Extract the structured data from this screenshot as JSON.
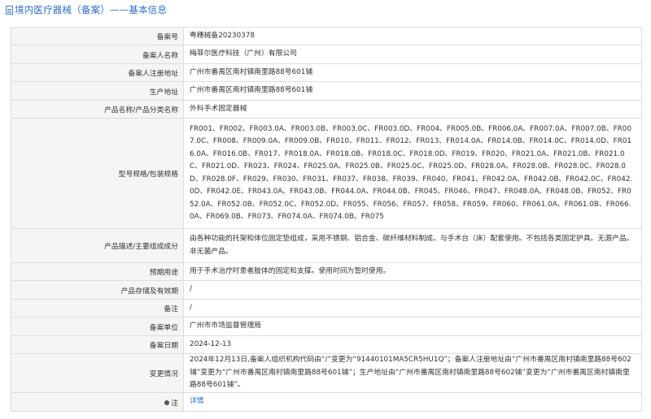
{
  "header": {
    "title": "境内医疗器械（备案）——基本信息",
    "icon": "document-icon"
  },
  "rows": [
    {
      "label": "备案号",
      "value": "粤穗械备20230378"
    },
    {
      "label": "备案人名称",
      "value": "梅菲尔医疗科技（广州）有限公司"
    },
    {
      "label": "备案人注册地址",
      "value": "广州市番禺区南村镇南里路88号601铺"
    },
    {
      "label": "生产地址",
      "value": "广州市番禺区南村镇南里路88号601铺"
    },
    {
      "label": "产品名称/产品分类名称",
      "value": "外科手术固定器械"
    },
    {
      "label": "型号规格/包装规格",
      "value": "FR001、FR002、FR003.0A、FR003.0B、FR003.0C、FR003.0D、FR004、FR005.0B、FR006.0A、FR007.0A、FR007.0B、FR007.0C、FR008、FR009.0A、FR009.0B、FR010、FR011、FR012、FR013、FR014.0A、FR014.0B、FR014.0C、FR014.0D、FR016.0A、FR016.0B、FR017、FR018.0A、FR018.0B、FR018.0C、FR018.0D、FR019、FR020、FR021.0A、FR021.0B、FR021.0C、FR021.0D、FR023、FR024、FR025.0A、FR025.0B、FR025.0C、FR025.0D、FR028.0A、FR028.0B、FR028.0C、FR028.0D、FR028.0F、FR029、FR030、FR031、FR037、FR038、FR039、FR040、FR041、FR042.0A、FR042.0B、FR042.0C、FR042.0D、FR042.0E、FR043.0A、FR043.0B、FR044.0A、FR044.0B、FR045、FR046、FR047、FR048.0A、FR048.0B、FR052、FR052.0A、FR052.0B、FR052.0C、FR052.0D、FR055、FR056、FR057、FR058、FR059、FR060、FR061.0A、FR061.0B、FR066.0A、FR069.0B、FR073、FR074.0A、FR074.0B、FR075"
    },
    {
      "label": "产品描述/主要组成成分",
      "value": "由各种功能的托架和体位固定垫组成，采用不锈钢、铝合金、碳纤维材料制成。与手术台（床）配套使用。不包括各类固定护具。无源产品。非无菌产品。"
    },
    {
      "label": "预期用途",
      "value": "用于手术治疗时患者肢体的固定和支撑。使用时间为暂时使用。"
    },
    {
      "label": "产品存储及有效期",
      "value": "/"
    },
    {
      "label": "备注",
      "value": "/"
    },
    {
      "label": "备案单位",
      "value": "广州市市场监督管理局"
    },
    {
      "label": "备案日期",
      "value": "2024-12-13"
    },
    {
      "label": "变更情况",
      "value": "2024年12月13日,备案人组织机构代码由“/”变更为“91440101MA5CR5HU1Q”；备案人注册地址由“广州市番禺区南村镇南里路88号602铺”变更为“广州市番禺区南村镇南里路88号601铺”；生产地址由“广州市番禺区南村镇南里路88号602铺”变更为“广州市番禺区南村镇南里路88号601铺”。"
    }
  ],
  "note_row": {
    "label": "注",
    "icon": "note-icon",
    "link_text": "详情"
  }
}
